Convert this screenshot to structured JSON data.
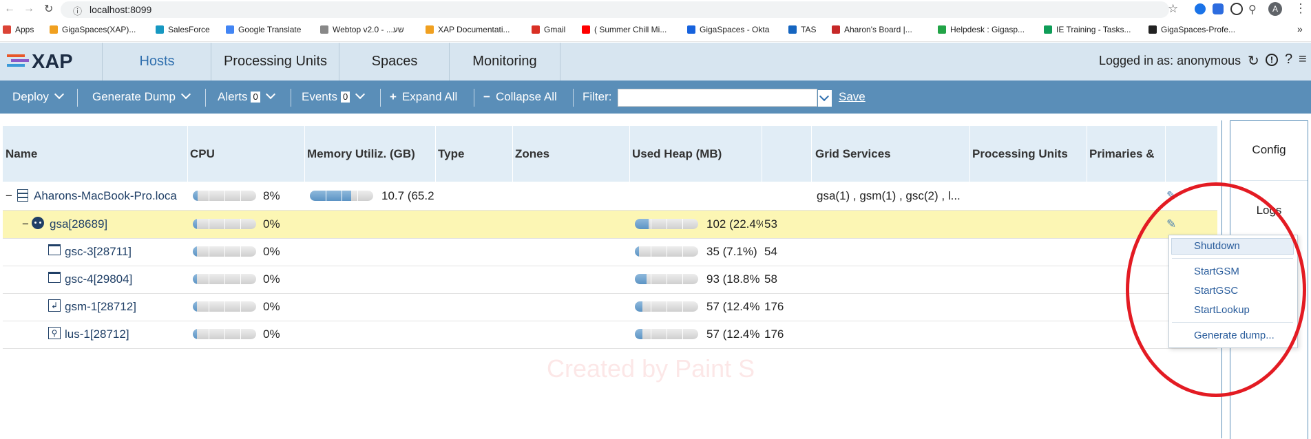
{
  "browser": {
    "url": "localhost:8099",
    "profile_initial": "A",
    "bookmarks": [
      {
        "label": "Apps",
        "icon": "apps-grid-icon",
        "color": "#db4437"
      },
      {
        "label": "GigaSpaces(XAP)...",
        "icon": "xap-icon",
        "color": "#f0a020"
      },
      {
        "label": "SalesForce",
        "icon": "cloud-icon",
        "color": "#1798c1"
      },
      {
        "label": "Google Translate",
        "icon": "translate-icon",
        "color": "#4285f4"
      },
      {
        "label": "Webtop v2.0 - ...שע",
        "icon": "webtop-icon",
        "color": "#888888"
      },
      {
        "label": "XAP Documentati...",
        "icon": "xap-icon",
        "color": "#f0a020"
      },
      {
        "label": "Gmail",
        "icon": "gmail-icon",
        "color": "#d93025"
      },
      {
        "label": "( Summer Chill Mi...",
        "icon": "youtube-icon",
        "color": "#ff0000"
      },
      {
        "label": "GigaSpaces - Okta",
        "icon": "okta-icon",
        "color": "#1662dd"
      },
      {
        "label": "TAS",
        "icon": "globe-icon",
        "color": "#1565c0"
      },
      {
        "label": "Aharon's Board |...",
        "icon": "board-icon",
        "color": "#c62828"
      },
      {
        "label": "Helpdesk : Gigasp...",
        "icon": "helpdesk-icon",
        "color": "#22a447"
      },
      {
        "label": "IE Training - Tasks...",
        "icon": "sheets-icon",
        "color": "#0f9d58"
      },
      {
        "label": "GigaSpaces-Profe...",
        "icon": "github-icon",
        "color": "#222222"
      }
    ]
  },
  "app": {
    "logo": "XAP",
    "tabs": [
      "Hosts",
      "Processing Units",
      "Spaces",
      "Monitoring"
    ],
    "active_tab": "Hosts",
    "logged_in": "Logged in as: anonymous"
  },
  "toolbar": {
    "deploy": "Deploy",
    "generate_dump": "Generate Dump",
    "alerts": "Alerts",
    "alerts_count": "0",
    "events": "Events",
    "events_count": "0",
    "expand_all": "Expand All",
    "collapse_all": "Collapse All",
    "filter_label": "Filter:",
    "filter_value": "",
    "save": "Save"
  },
  "grid": {
    "columns": [
      "Name",
      "CPU",
      "Memory Utiliz. (GB)",
      "Type",
      "Zones",
      "Used Heap (MB)",
      "Grid Services",
      "Processing Units",
      "Primaries &"
    ],
    "rows": [
      {
        "name": "Aharons-MacBook-Pro.loca",
        "cpu": "8%",
        "cpu_fraction": 0.08,
        "memory": "10.7 (65.2",
        "memory_fraction": 0.65,
        "heap": "",
        "threads": "",
        "grid_services": "gsa(1) , gsm(1) , gsc(2) , l...",
        "icon": "server-icon"
      },
      {
        "name": "gsa[28689]",
        "cpu": "0%",
        "cpu_fraction": 0.0,
        "memory": "",
        "heap": "102 (22.4%",
        "heap_fraction": 0.22,
        "threads": "53",
        "grid_services": "",
        "icon": "gsa-agent-icon"
      },
      {
        "name": "gsc-3[28711]",
        "cpu": "0%",
        "cpu_fraction": 0.0,
        "memory": "",
        "heap": "35 (7.1%)",
        "heap_fraction": 0.07,
        "threads": "54",
        "grid_services": "",
        "icon": "container-icon"
      },
      {
        "name": "gsc-4[29804]",
        "cpu": "0%",
        "cpu_fraction": 0.0,
        "memory": "",
        "heap": "93 (18.8%",
        "heap_fraction": 0.19,
        "threads": "58",
        "grid_services": "",
        "icon": "container-icon"
      },
      {
        "name": "gsm-1[28712]",
        "cpu": "0%",
        "cpu_fraction": 0.0,
        "memory": "",
        "heap": "57 (12.4%",
        "heap_fraction": 0.12,
        "threads": "176",
        "grid_services": "",
        "icon": "manager-icon"
      },
      {
        "name": "lus-1[28712]",
        "cpu": "0%",
        "cpu_fraction": 0.0,
        "memory": "",
        "heap": "57 (12.4%",
        "heap_fraction": 0.12,
        "threads": "176",
        "grid_services": "",
        "icon": "lookup-icon"
      }
    ]
  },
  "side_panel": {
    "config": "Config",
    "logs": "Logs"
  },
  "context_menu": [
    "Shutdown",
    "StartGSM",
    "StartGSC",
    "StartLookup",
    "Generate dump..."
  ],
  "watermark": "Created by Paint S",
  "colors": {
    "accent": "#5a8eb8",
    "header_bg": "#d7e5f0",
    "selected_row": "#fcf6b4",
    "annotation": "#e31b23"
  }
}
